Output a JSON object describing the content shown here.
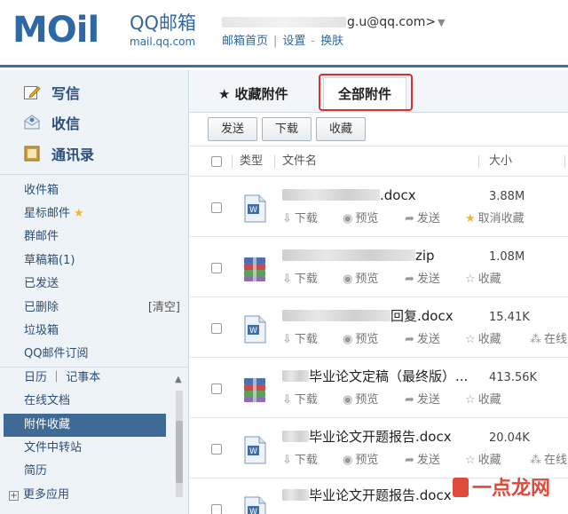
{
  "header": {
    "logo_text": "MOil",
    "brand_name": "QQ邮箱",
    "brand_domain": "mail.qq.com",
    "account_email": "g.u@qq.com>",
    "nav": [
      "邮箱首页",
      "设置",
      "换肤"
    ],
    "nav_separator": "|",
    "nav_separator2": "-"
  },
  "sidebar": {
    "quick_actions": [
      {
        "label": "写信",
        "icon": "compose-icon"
      },
      {
        "label": "收信",
        "icon": "inbox-icon"
      },
      {
        "label": "通讯录",
        "icon": "contacts-icon"
      }
    ],
    "folders": [
      {
        "label": "收件箱"
      },
      {
        "label": "星标邮件",
        "icon": "star-icon"
      },
      {
        "label": "群邮件"
      },
      {
        "label": "草稿箱(1)"
      },
      {
        "label": "已发送"
      },
      {
        "label": "已删除",
        "right": "[清空]"
      },
      {
        "label": "垃圾箱"
      },
      {
        "label": "QQ邮件订阅"
      }
    ],
    "apps": [
      {
        "label": "日历 ｜ 记事本"
      },
      {
        "label": "在线文档"
      },
      {
        "label": "附件收藏",
        "active": true
      },
      {
        "label": "文件中转站"
      },
      {
        "label": "简历"
      }
    ],
    "more_apps": "更多应用"
  },
  "tabs": {
    "favorites": "★ 收藏附件",
    "all": "全部附件"
  },
  "toolbar": {
    "send": "发送",
    "download": "下载",
    "favorite": "收藏"
  },
  "list_header": {
    "type": "类型",
    "filename": "文件名",
    "size": "大小"
  },
  "files": [
    {
      "name_suffix": ".docx",
      "type": "word",
      "size": "3.88M",
      "actions": [
        "下载",
        "预览",
        "发送",
        "取消收藏"
      ],
      "favorited": true
    },
    {
      "name_suffix": "zip",
      "type": "archive",
      "size": "1.08M",
      "actions": [
        "下载",
        "预览",
        "发送",
        "收藏"
      ],
      "favorited": false
    },
    {
      "name_suffix": "回复.docx",
      "type": "word",
      "size": "15.41K",
      "actions": [
        "下载",
        "预览",
        "发送",
        "收藏",
        "在线"
      ],
      "favorited": false
    },
    {
      "name_suffix": "毕业论文定稿（最终版）...",
      "type": "archive",
      "size": "413.56K",
      "actions": [
        "下载",
        "预览",
        "发送",
        "收藏"
      ],
      "favorited": false
    },
    {
      "name_suffix": "毕业论文开题报告.docx",
      "type": "word",
      "size": "20.04K",
      "actions": [
        "下载",
        "预览",
        "发送",
        "收藏",
        "在线"
      ],
      "favorited": false
    },
    {
      "name_suffix": "毕业论文开题报告.docx",
      "type": "word",
      "size": "",
      "actions": [],
      "favorited": false
    }
  ],
  "watermark": "一点龙网",
  "colors": {
    "brand_blue": "#2e68a5",
    "sidebar_bg": "#eef3f8",
    "active_item": "#3f6a96",
    "highlight_red": "#e02c2c",
    "star_gold": "#f2b632"
  }
}
